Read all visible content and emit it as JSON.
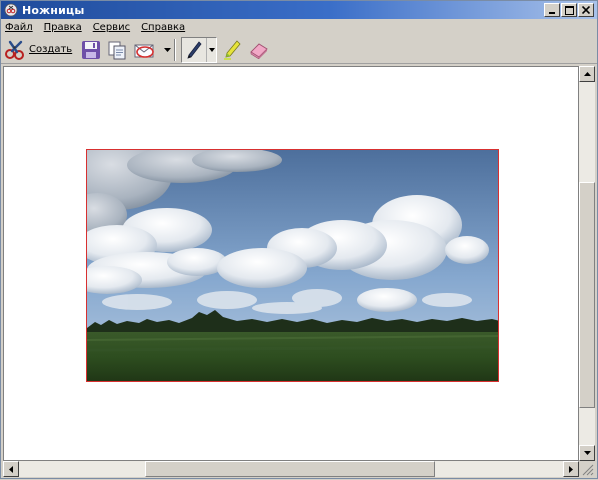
{
  "window": {
    "title": "Ножницы",
    "minimize_label": "Minimize",
    "maximize_label": "Maximize",
    "close_label": "Close"
  },
  "menu": {
    "items": [
      "Файл",
      "Правка",
      "Сервис",
      "Справка"
    ]
  },
  "toolbar": {
    "create_label": "Создать",
    "icons": [
      "scissors-icon",
      "save-icon",
      "copy-icon",
      "send-email-icon",
      "pen-icon",
      "highlighter-icon",
      "eraser-icon"
    ]
  },
  "colors": {
    "titlebar_start": "#1f4b9b",
    "titlebar_end": "#a9c2ea",
    "snip_border": "#d83030",
    "canvas_bg": "#ffffff"
  },
  "snip": {
    "subject": "sky with cumulus clouds over a green field"
  }
}
